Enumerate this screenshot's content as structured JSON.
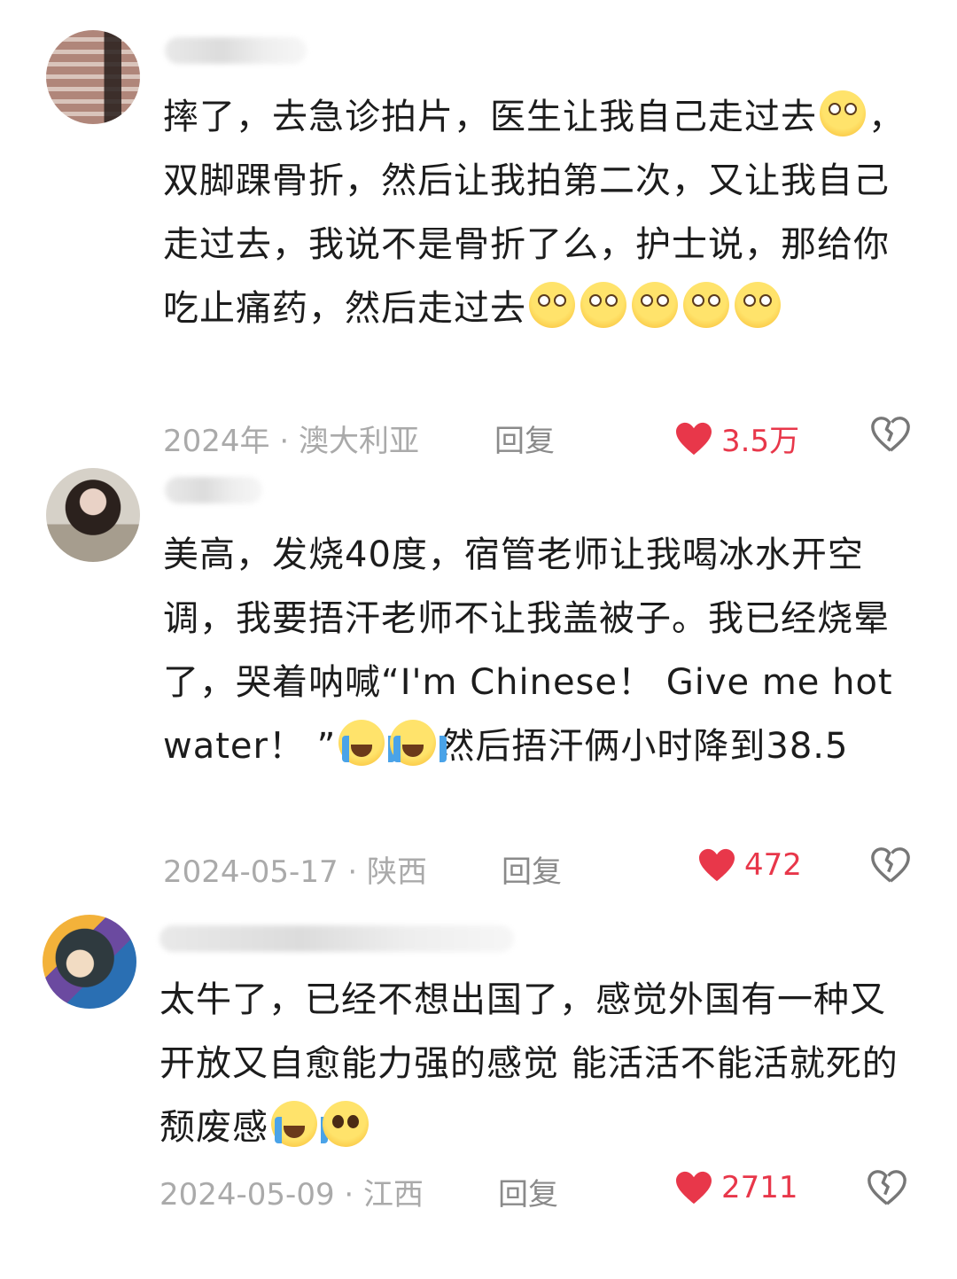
{
  "comments": [
    {
      "text_before": "摔了，去急诊拍片，医生让我自己走过去",
      "emoji_1": "flushed-face",
      "text_after": "，双脚踝骨折，然后让我拍第二次，又让我自己走过去，我说不是骨折了么，护士说，那给你吃止痛药，然后走过去",
      "emoji_2": "flushed-face x5",
      "date": "2024年",
      "location": "澳大利亚",
      "reply_label": "回复",
      "likes": "3.5万"
    },
    {
      "text_before": "美高，发烧40度，宿管老师让我喝冰水开空调，我要捂汗老师不让我盖被子。我已经烧晕了，哭着呐喊“I'm Chinese！ Give me hot water！ ”",
      "emoji_1": "loudly-crying-face x2",
      "text_after": "然后捂汗俩小时降到38.5",
      "date": "2024-05-17",
      "location": "陕西",
      "reply_label": "回复",
      "likes": "472"
    },
    {
      "text_before": "太牛了，已经不想出国了，感觉外国有一种又开放又自愈能力强的感觉 能活活不能活就死的颓废感",
      "emoji_1": "laughing-crying + pleading-face",
      "date": "2024-05-09",
      "location": "江西",
      "reply_label": "回复",
      "likes": "2711"
    }
  ],
  "separator": " · ",
  "colors": {
    "like_red": "#e8374a",
    "meta_gray": "#aaaaaa",
    "text": "#1c1c1c"
  },
  "icons": {
    "like": "heart-icon",
    "dislike": "broken-heart-icon"
  }
}
